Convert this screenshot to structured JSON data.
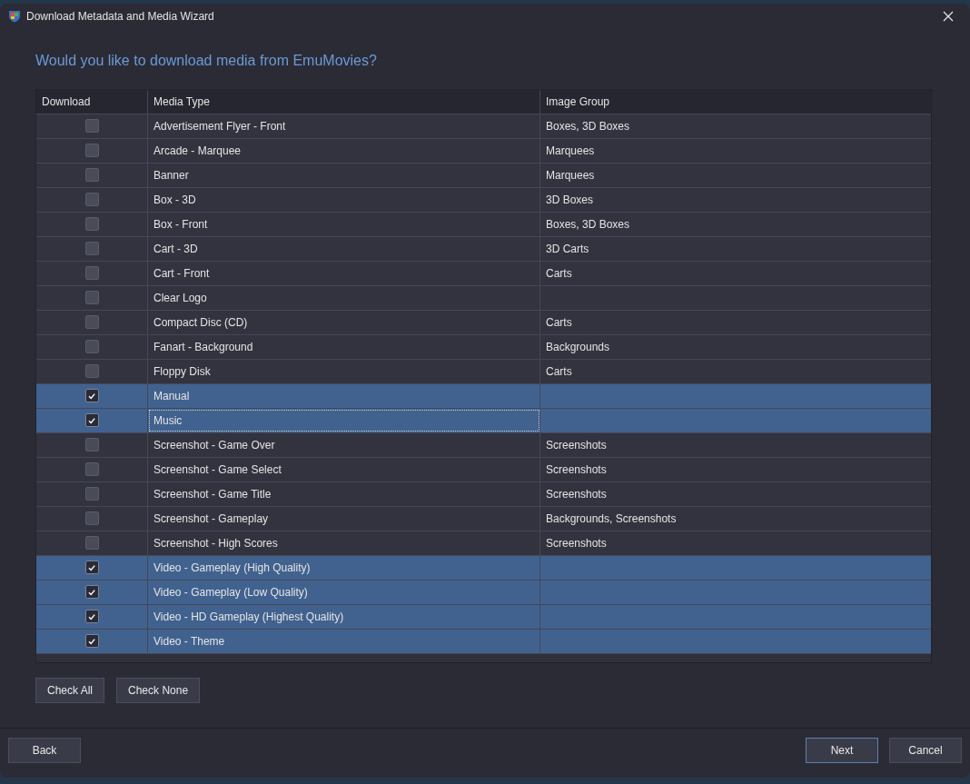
{
  "window": {
    "title": "Download Metadata and Media Wizard"
  },
  "heading": "Would you like to download media from EmuMovies?",
  "table": {
    "columns": [
      "Download",
      "Media Type",
      "Image Group"
    ],
    "rows": [
      {
        "checked": false,
        "selected": false,
        "focused": false,
        "media_type": "Advertisement Flyer - Front",
        "image_group": "Boxes, 3D Boxes"
      },
      {
        "checked": false,
        "selected": false,
        "focused": false,
        "media_type": "Arcade - Marquee",
        "image_group": "Marquees"
      },
      {
        "checked": false,
        "selected": false,
        "focused": false,
        "media_type": "Banner",
        "image_group": "Marquees"
      },
      {
        "checked": false,
        "selected": false,
        "focused": false,
        "media_type": "Box - 3D",
        "image_group": "3D Boxes"
      },
      {
        "checked": false,
        "selected": false,
        "focused": false,
        "media_type": "Box - Front",
        "image_group": "Boxes, 3D Boxes"
      },
      {
        "checked": false,
        "selected": false,
        "focused": false,
        "media_type": "Cart - 3D",
        "image_group": "3D Carts"
      },
      {
        "checked": false,
        "selected": false,
        "focused": false,
        "media_type": "Cart - Front",
        "image_group": "Carts"
      },
      {
        "checked": false,
        "selected": false,
        "focused": false,
        "media_type": "Clear Logo"
      },
      {
        "checked": false,
        "selected": false,
        "focused": false,
        "media_type": "Compact Disc (CD)",
        "image_group": "Carts"
      },
      {
        "checked": false,
        "selected": false,
        "focused": false,
        "media_type": "Fanart - Background",
        "image_group": "Backgrounds"
      },
      {
        "checked": false,
        "selected": false,
        "focused": false,
        "media_type": "Floppy Disk",
        "image_group": "Carts"
      },
      {
        "checked": true,
        "selected": true,
        "focused": false,
        "media_type": "Manual"
      },
      {
        "checked": true,
        "selected": true,
        "focused": true,
        "media_type": "Music"
      },
      {
        "checked": false,
        "selected": false,
        "focused": false,
        "media_type": "Screenshot - Game Over",
        "image_group": "Screenshots"
      },
      {
        "checked": false,
        "selected": false,
        "focused": false,
        "media_type": "Screenshot - Game Select",
        "image_group": "Screenshots"
      },
      {
        "checked": false,
        "selected": false,
        "focused": false,
        "media_type": "Screenshot - Game Title",
        "image_group": "Screenshots"
      },
      {
        "checked": false,
        "selected": false,
        "focused": false,
        "media_type": "Screenshot - Gameplay",
        "image_group": "Backgrounds, Screenshots"
      },
      {
        "checked": false,
        "selected": false,
        "focused": false,
        "media_type": "Screenshot - High Scores",
        "image_group": "Screenshots"
      },
      {
        "checked": true,
        "selected": true,
        "focused": false,
        "media_type": "Video - Gameplay (High Quality)"
      },
      {
        "checked": true,
        "selected": true,
        "focused": false,
        "media_type": "Video - Gameplay (Low Quality)"
      },
      {
        "checked": true,
        "selected": true,
        "focused": false,
        "media_type": "Video - HD Gameplay (Highest Quality)"
      },
      {
        "checked": true,
        "selected": true,
        "focused": false,
        "media_type": "Video - Theme"
      }
    ]
  },
  "table_buttons": [
    "Check All",
    "Check None"
  ],
  "footer": {
    "left_buttons": [
      {
        "label": "Back",
        "default": false
      }
    ],
    "right_buttons": [
      {
        "label": "Next",
        "default": true
      },
      {
        "label": "Cancel",
        "default": false
      }
    ]
  }
}
